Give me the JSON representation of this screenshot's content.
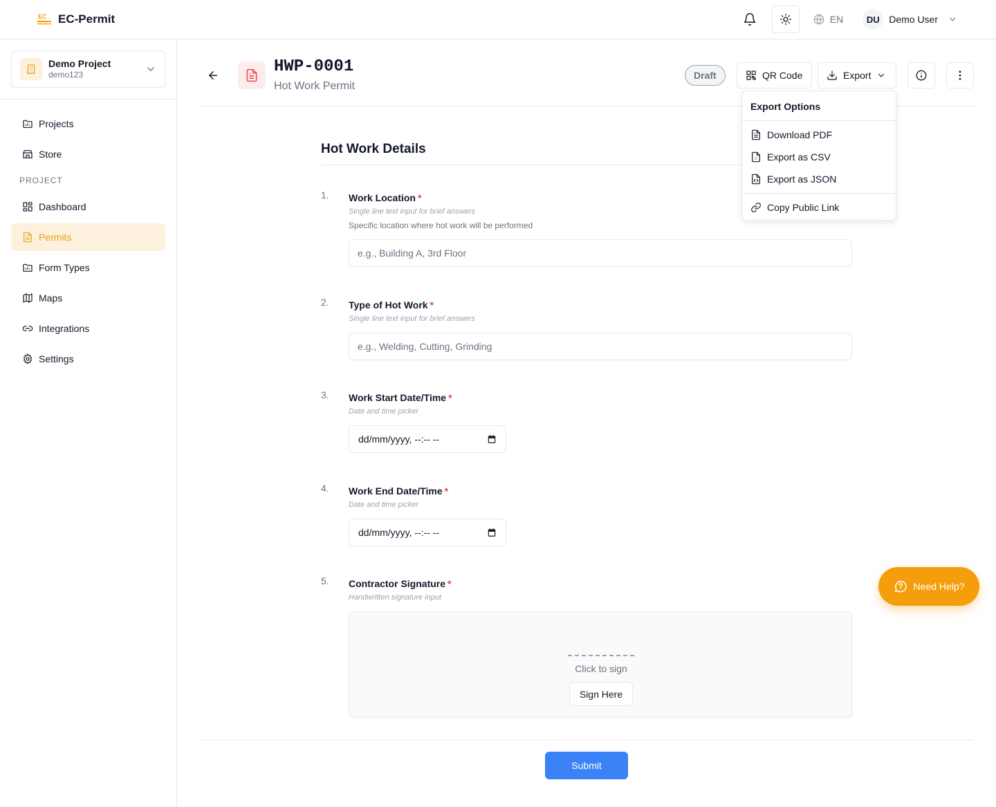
{
  "app": {
    "logo_text": "EC",
    "name": "EC-Permit"
  },
  "topbar": {
    "language": "EN",
    "user_initials": "DU",
    "user_name": "Demo User"
  },
  "sidebar": {
    "project": {
      "name": "Demo Project",
      "slug": "demo123"
    },
    "top_items": [
      {
        "label": "Projects",
        "icon": "folder-chart-icon"
      },
      {
        "label": "Store",
        "icon": "store-icon"
      }
    ],
    "section_label": "PROJECT",
    "project_items": [
      {
        "label": "Dashboard",
        "icon": "dashboard-icon",
        "active": false
      },
      {
        "label": "Permits",
        "icon": "document-icon",
        "active": true
      },
      {
        "label": "Form Types",
        "icon": "folder-icon",
        "active": false
      },
      {
        "label": "Maps",
        "icon": "map-icon",
        "active": false
      },
      {
        "label": "Integrations",
        "icon": "link-icon",
        "active": false
      },
      {
        "label": "Settings",
        "icon": "gear-icon",
        "active": false
      }
    ]
  },
  "header": {
    "permit_id": "HWP-0001",
    "permit_type": "Hot Work Permit",
    "status": "Draft",
    "qr_label": "QR Code",
    "export_label": "Export"
  },
  "export_menu": {
    "title": "Export Options",
    "items": [
      {
        "label": "Download PDF",
        "icon": "file-pdf-icon"
      },
      {
        "label": "Export as CSV",
        "icon": "file-csv-icon"
      },
      {
        "label": "Export as JSON",
        "icon": "file-json-icon"
      }
    ],
    "link_item": {
      "label": "Copy Public Link",
      "icon": "link-icon"
    }
  },
  "form": {
    "title": "Hot Work Details",
    "fields": [
      {
        "num": "1.",
        "label": "Work Location",
        "hint": "Single line text input for brief answers",
        "description": "Specific location where hot work will be performed",
        "placeholder": "e.g., Building A, 3rd Floor",
        "value": ""
      },
      {
        "num": "2.",
        "label": "Type of Hot Work",
        "hint": "Single line text input for brief answers",
        "placeholder": "e.g., Welding, Cutting, Grinding",
        "value": ""
      },
      {
        "num": "3.",
        "label": "Work Start Date/Time",
        "hint": "Date and time picker",
        "value": "dd/mm/yyyy, --:-- --"
      },
      {
        "num": "4.",
        "label": "Work End Date/Time",
        "hint": "Date and time picker",
        "value": "dd/mm/yyyy, --:-- --"
      },
      {
        "num": "5.",
        "label": "Contractor Signature",
        "hint": "Handwritten signature input",
        "sig_prompt": "Click to sign",
        "sig_button": "Sign Here"
      }
    ],
    "required_marker": "*",
    "submit_label": "Submit"
  },
  "help": {
    "label": "Need Help?"
  },
  "colors": {
    "accent": "#f59e0b",
    "active_bg": "#fdf0dc",
    "primary_blue": "#3b82f6",
    "required_red": "#ef4444",
    "border": "#e5e7eb"
  }
}
